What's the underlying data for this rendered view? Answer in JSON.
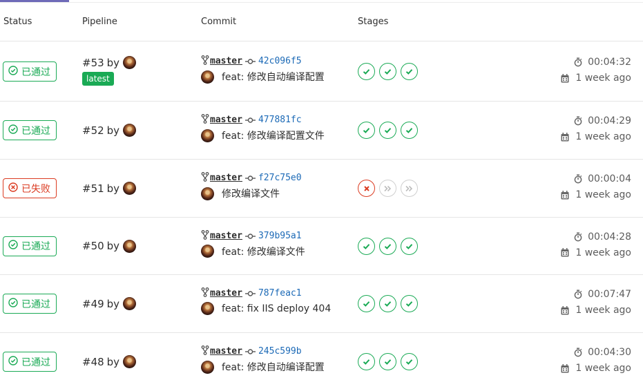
{
  "header": {
    "status": "Status",
    "pipeline": "Pipeline",
    "commit": "Commit",
    "stages": "Stages"
  },
  "colors": {
    "success": "#1aaa55",
    "failed": "#db3b21",
    "skipped": "#cfcfcf",
    "link": "#1b69b6"
  },
  "rows": [
    {
      "status": "success",
      "status_label": "已通过",
      "pipeline": "#53",
      "by": "by",
      "latest": "latest",
      "branch": "master",
      "sha": "42c096f5",
      "message": "feat: 修改自动编译配置",
      "stages": [
        "success",
        "success",
        "success"
      ],
      "duration": "00:04:32",
      "finished": "1 week ago"
    },
    {
      "status": "success",
      "status_label": "已通过",
      "pipeline": "#52",
      "by": "by",
      "branch": "master",
      "sha": "477881fc",
      "message": "feat: 修改编译配置文件",
      "stages": [
        "success",
        "success",
        "success"
      ],
      "duration": "00:04:29",
      "finished": "1 week ago"
    },
    {
      "status": "failed",
      "status_label": "已失败",
      "pipeline": "#51",
      "by": "by",
      "branch": "master",
      "sha": "f27c75e0",
      "message": "修改编译文件",
      "stages": [
        "failed",
        "skipped",
        "skipped"
      ],
      "duration": "00:00:04",
      "finished": "1 week ago"
    },
    {
      "status": "success",
      "status_label": "已通过",
      "pipeline": "#50",
      "by": "by",
      "branch": "master",
      "sha": "379b95a1",
      "message": "feat: 修改编译文件",
      "stages": [
        "success",
        "success",
        "success"
      ],
      "duration": "00:04:28",
      "finished": "1 week ago"
    },
    {
      "status": "success",
      "status_label": "已通过",
      "pipeline": "#49",
      "by": "by",
      "branch": "master",
      "sha": "787feac1",
      "message": "feat: fix IIS deploy 404",
      "stages": [
        "success",
        "success",
        "success"
      ],
      "duration": "00:07:47",
      "finished": "1 week ago"
    },
    {
      "status": "success",
      "status_label": "已通过",
      "pipeline": "#48",
      "by": "by",
      "branch": "master",
      "sha": "245c599b",
      "message": "feat: 修改自动编译配置",
      "stages": [
        "success",
        "success",
        "success"
      ],
      "duration": "00:04:30",
      "finished": "1 week ago"
    }
  ]
}
